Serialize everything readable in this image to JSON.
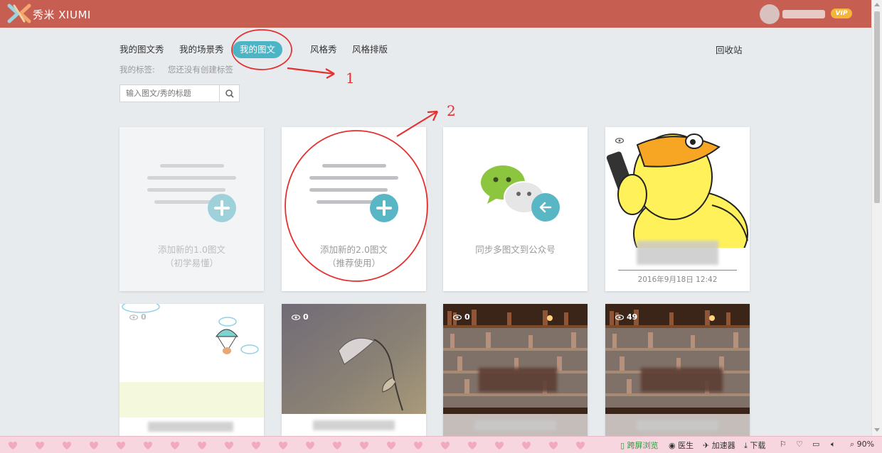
{
  "app": {
    "logo_text": "秀米 XIUMI",
    "vip_badge": "VIP"
  },
  "tabs": [
    {
      "label": "我的图文秀",
      "active": false
    },
    {
      "label": "我的场景秀",
      "active": false
    },
    {
      "label": "我的图文",
      "active": true
    },
    {
      "label": "风格秀",
      "active": false
    },
    {
      "label": "风格排版",
      "active": false
    }
  ],
  "recycle_label": "回收站",
  "tags": {
    "label": "我的标签:",
    "empty_text": "您还没有创建标签"
  },
  "search": {
    "placeholder": "输入图文/秀的标题"
  },
  "cards": [
    {
      "line1": "添加新的1.0图文",
      "line2": "（初学易懂）"
    },
    {
      "line1": "添加新的2.0图文",
      "line2": "（推荐使用）"
    },
    {
      "line1": "同步多图文到公众号"
    },
    {
      "date": "2016年9月18日 12:42"
    }
  ],
  "view_counts": [
    "0",
    "0",
    "0",
    "49"
  ],
  "annotations": [
    "1",
    "2"
  ],
  "statusbar": {
    "cross_screen": "跨屏浏览",
    "doctor": "医生",
    "accelerator": "加速器",
    "download": "下载",
    "zoom": "90%"
  },
  "colors": {
    "header": "#c65f52",
    "accent": "#4bb5c6",
    "plus": "#59b6c5",
    "annotation": "#e53030"
  },
  "icons": [
    "logo-icon",
    "search-icon",
    "eye-icon",
    "plus-icon",
    "wechat-icon",
    "back-arrow-icon"
  ]
}
